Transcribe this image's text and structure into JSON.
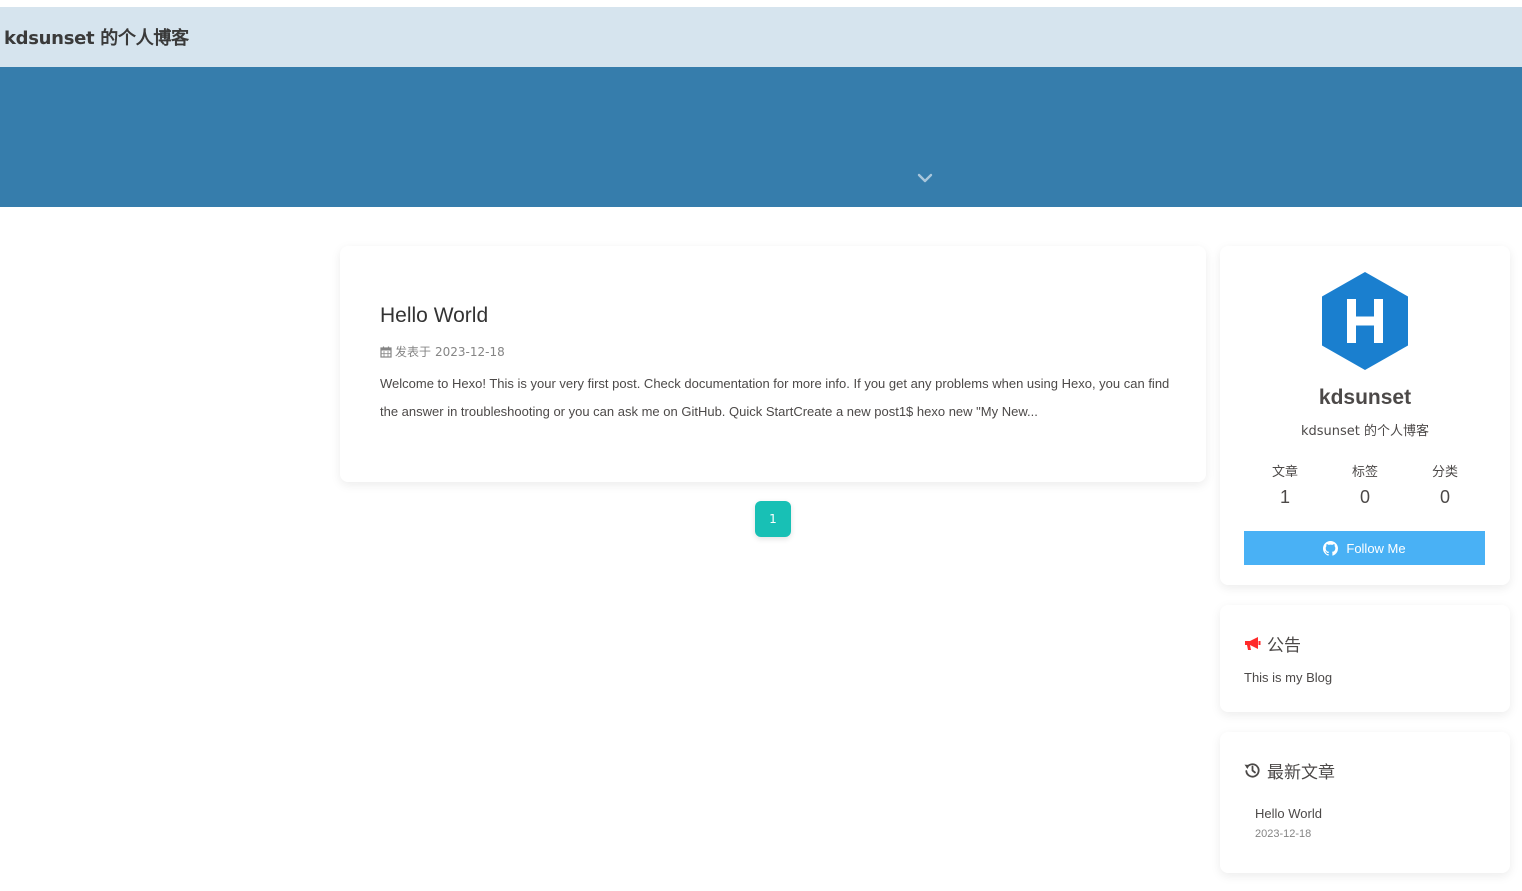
{
  "nav": {
    "site_name": "kdsunset 的个人博客"
  },
  "banner": {
    "scroll_icon": "chevron-down-icon"
  },
  "post": {
    "title": "Hello World",
    "meta_label": "发表于",
    "date": "2023-12-18",
    "excerpt": "Welcome to Hexo! This is your very first post. Check documentation for more info. If you get any problems when using Hexo, you can find the answer in troubleshooting or you can ask me on GitHub. Quick StartCreate a new post1$ hexo new \"My New..."
  },
  "pagination": {
    "current": "1"
  },
  "author": {
    "name": "kdsunset",
    "description": "kdsunset 的个人博客",
    "stats": [
      {
        "label": "文章",
        "value": "1"
      },
      {
        "label": "标签",
        "value": "0"
      },
      {
        "label": "分类",
        "value": "0"
      }
    ],
    "follow_label": "Follow Me"
  },
  "notice": {
    "heading": "公告",
    "text": "This is my Blog"
  },
  "recent": {
    "heading": "最新文章",
    "items": [
      {
        "title": "Hello World",
        "date": "2023-12-18"
      }
    ]
  },
  "colors": {
    "nav_bg": "#d6e4ee",
    "banner_bg": "#367dac",
    "pager_bg": "#18c0b5",
    "follow_bg": "#49b1f5",
    "hexo_logo": "#1a7fcf",
    "notice_icon": "#ff2a2a"
  }
}
